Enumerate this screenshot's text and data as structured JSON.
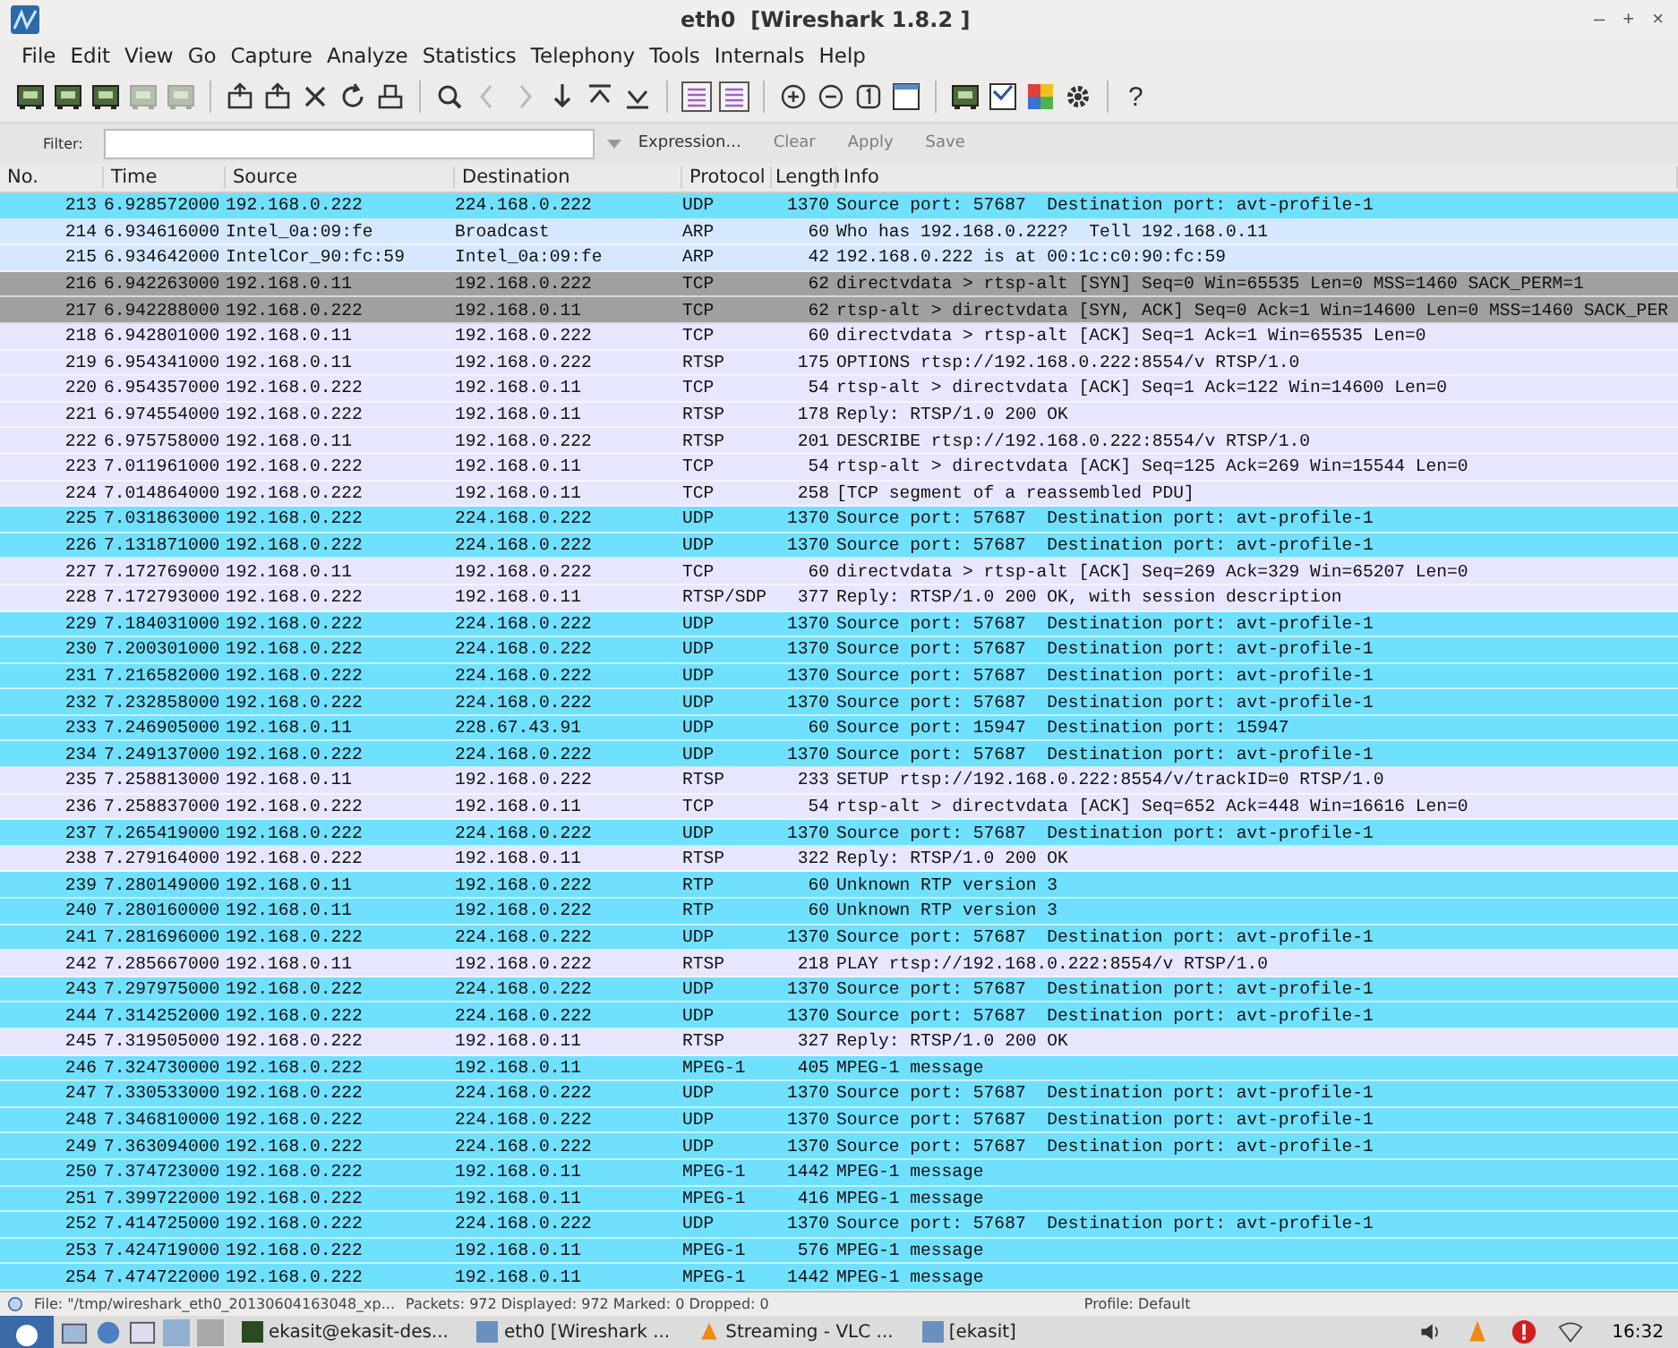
{
  "window": {
    "title": "eth0  [Wireshark 1.8.2 ]",
    "controls": [
      "–",
      "+",
      "×"
    ]
  },
  "menu": [
    "File",
    "Edit",
    "View",
    "Go",
    "Capture",
    "Analyze",
    "Statistics",
    "Telephony",
    "Tools",
    "Internals",
    "Help"
  ],
  "toolbar": {
    "help": "?"
  },
  "filter": {
    "label": "Filter:",
    "buttons": [
      {
        "label": "Expression...",
        "disabled": false
      },
      {
        "label": "Clear",
        "disabled": true
      },
      {
        "label": "Apply",
        "disabled": true
      },
      {
        "label": "Save",
        "disabled": true
      }
    ]
  },
  "table": {
    "columns": [
      "No.",
      "Time",
      "Source",
      "Destination",
      "Protocol",
      "Length",
      "Info"
    ],
    "rows": [
      {
        "no": "213",
        "time": "6.928572000",
        "source": "192.168.0.222",
        "destination": "224.168.0.222",
        "protocol": "UDP",
        "length": "1370",
        "info": "Source port: 57687  Destination port: avt-profile-1",
        "color": "#70e0ff"
      },
      {
        "no": "214",
        "time": "6.934616000",
        "source": "Intel_0a:09:fe",
        "destination": "Broadcast",
        "protocol": "ARP",
        "length": "60",
        "info": "Who has 192.168.0.222?  Tell 192.168.0.11",
        "color": "#d6e8ff"
      },
      {
        "no": "215",
        "time": "6.934642000",
        "source": "IntelCor_90:fc:59",
        "destination": "Intel_0a:09:fe",
        "protocol": "ARP",
        "length": "42",
        "info": "192.168.0.222 is at 00:1c:c0:90:fc:59",
        "color": "#d6e8ff"
      },
      {
        "no": "216",
        "time": "6.942263000",
        "source": "192.168.0.11",
        "destination": "192.168.0.222",
        "protocol": "TCP",
        "length": "62",
        "info": "directvdata > rtsp-alt [SYN] Seq=0 Win=65535 Len=0 MSS=1460 SACK_PERM=1",
        "color": "#a0a0a0"
      },
      {
        "no": "217",
        "time": "6.942288000",
        "source": "192.168.0.222",
        "destination": "192.168.0.11",
        "protocol": "TCP",
        "length": "62",
        "info": "rtsp-alt > directvdata [SYN, ACK] Seq=0 Ack=1 Win=14600 Len=0 MSS=1460 SACK_PER",
        "color": "#a0a0a0"
      },
      {
        "no": "218",
        "time": "6.942801000",
        "source": "192.168.0.11",
        "destination": "192.168.0.222",
        "protocol": "TCP",
        "length": "60",
        "info": "directvdata > rtsp-alt [ACK] Seq=1 Ack=1 Win=65535 Len=0",
        "color": "#e7e6ff"
      },
      {
        "no": "219",
        "time": "6.954341000",
        "source": "192.168.0.11",
        "destination": "192.168.0.222",
        "protocol": "RTSP",
        "length": "175",
        "info": "OPTIONS rtsp://192.168.0.222:8554/v RTSP/1.0",
        "color": "#e7e6ff"
      },
      {
        "no": "220",
        "time": "6.954357000",
        "source": "192.168.0.222",
        "destination": "192.168.0.11",
        "protocol": "TCP",
        "length": "54",
        "info": "rtsp-alt > directvdata [ACK] Seq=1 Ack=122 Win=14600 Len=0",
        "color": "#e7e6ff"
      },
      {
        "no": "221",
        "time": "6.974554000",
        "source": "192.168.0.222",
        "destination": "192.168.0.11",
        "protocol": "RTSP",
        "length": "178",
        "info": "Reply: RTSP/1.0 200 OK",
        "color": "#e7e6ff"
      },
      {
        "no": "222",
        "time": "6.975758000",
        "source": "192.168.0.11",
        "destination": "192.168.0.222",
        "protocol": "RTSP",
        "length": "201",
        "info": "DESCRIBE rtsp://192.168.0.222:8554/v RTSP/1.0",
        "color": "#e7e6ff"
      },
      {
        "no": "223",
        "time": "7.011961000",
        "source": "192.168.0.222",
        "destination": "192.168.0.11",
        "protocol": "TCP",
        "length": "54",
        "info": "rtsp-alt > directvdata [ACK] Seq=125 Ack=269 Win=15544 Len=0",
        "color": "#e7e6ff"
      },
      {
        "no": "224",
        "time": "7.014864000",
        "source": "192.168.0.222",
        "destination": "192.168.0.11",
        "protocol": "TCP",
        "length": "258",
        "info": "[TCP segment of a reassembled PDU]",
        "color": "#e7e6ff"
      },
      {
        "no": "225",
        "time": "7.031863000",
        "source": "192.168.0.222",
        "destination": "224.168.0.222",
        "protocol": "UDP",
        "length": "1370",
        "info": "Source port: 57687  Destination port: avt-profile-1",
        "color": "#70e0ff"
      },
      {
        "no": "226",
        "time": "7.131871000",
        "source": "192.168.0.222",
        "destination": "224.168.0.222",
        "protocol": "UDP",
        "length": "1370",
        "info": "Source port: 57687  Destination port: avt-profile-1",
        "color": "#70e0ff"
      },
      {
        "no": "227",
        "time": "7.172769000",
        "source": "192.168.0.11",
        "destination": "192.168.0.222",
        "protocol": "TCP",
        "length": "60",
        "info": "directvdata > rtsp-alt [ACK] Seq=269 Ack=329 Win=65207 Len=0",
        "color": "#e7e6ff"
      },
      {
        "no": "228",
        "time": "7.172793000",
        "source": "192.168.0.222",
        "destination": "192.168.0.11",
        "protocol": "RTSP/SDP",
        "length": "377",
        "info": "Reply: RTSP/1.0 200 OK, with session description",
        "color": "#e7e6ff"
      },
      {
        "no": "229",
        "time": "7.184031000",
        "source": "192.168.0.222",
        "destination": "224.168.0.222",
        "protocol": "UDP",
        "length": "1370",
        "info": "Source port: 57687  Destination port: avt-profile-1",
        "color": "#70e0ff"
      },
      {
        "no": "230",
        "time": "7.200301000",
        "source": "192.168.0.222",
        "destination": "224.168.0.222",
        "protocol": "UDP",
        "length": "1370",
        "info": "Source port: 57687  Destination port: avt-profile-1",
        "color": "#70e0ff"
      },
      {
        "no": "231",
        "time": "7.216582000",
        "source": "192.168.0.222",
        "destination": "224.168.0.222",
        "protocol": "UDP",
        "length": "1370",
        "info": "Source port: 57687  Destination port: avt-profile-1",
        "color": "#70e0ff"
      },
      {
        "no": "232",
        "time": "7.232858000",
        "source": "192.168.0.222",
        "destination": "224.168.0.222",
        "protocol": "UDP",
        "length": "1370",
        "info": "Source port: 57687  Destination port: avt-profile-1",
        "color": "#70e0ff"
      },
      {
        "no": "233",
        "time": "7.246905000",
        "source": "192.168.0.11",
        "destination": "228.67.43.91",
        "protocol": "UDP",
        "length": "60",
        "info": "Source port: 15947  Destination port: 15947",
        "color": "#70e0ff"
      },
      {
        "no": "234",
        "time": "7.249137000",
        "source": "192.168.0.222",
        "destination": "224.168.0.222",
        "protocol": "UDP",
        "length": "1370",
        "info": "Source port: 57687  Destination port: avt-profile-1",
        "color": "#70e0ff"
      },
      {
        "no": "235",
        "time": "7.258813000",
        "source": "192.168.0.11",
        "destination": "192.168.0.222",
        "protocol": "RTSP",
        "length": "233",
        "info": "SETUP rtsp://192.168.0.222:8554/v/trackID=0 RTSP/1.0",
        "color": "#e7e6ff"
      },
      {
        "no": "236",
        "time": "7.258837000",
        "source": "192.168.0.222",
        "destination": "192.168.0.11",
        "protocol": "TCP",
        "length": "54",
        "info": "rtsp-alt > directvdata [ACK] Seq=652 Ack=448 Win=16616 Len=0",
        "color": "#e7e6ff"
      },
      {
        "no": "237",
        "time": "7.265419000",
        "source": "192.168.0.222",
        "destination": "224.168.0.222",
        "protocol": "UDP",
        "length": "1370",
        "info": "Source port: 57687  Destination port: avt-profile-1",
        "color": "#70e0ff"
      },
      {
        "no": "238",
        "time": "7.279164000",
        "source": "192.168.0.222",
        "destination": "192.168.0.11",
        "protocol": "RTSP",
        "length": "322",
        "info": "Reply: RTSP/1.0 200 OK",
        "color": "#e7e6ff"
      },
      {
        "no": "239",
        "time": "7.280149000",
        "source": "192.168.0.11",
        "destination": "192.168.0.222",
        "protocol": "RTP",
        "length": "60",
        "info": "Unknown RTP version 3",
        "color": "#70e0ff"
      },
      {
        "no": "240",
        "time": "7.280160000",
        "source": "192.168.0.11",
        "destination": "192.168.0.222",
        "protocol": "RTP",
        "length": "60",
        "info": "Unknown RTP version 3",
        "color": "#70e0ff"
      },
      {
        "no": "241",
        "time": "7.281696000",
        "source": "192.168.0.222",
        "destination": "224.168.0.222",
        "protocol": "UDP",
        "length": "1370",
        "info": "Source port: 57687  Destination port: avt-profile-1",
        "color": "#70e0ff"
      },
      {
        "no": "242",
        "time": "7.285667000",
        "source": "192.168.0.11",
        "destination": "192.168.0.222",
        "protocol": "RTSP",
        "length": "218",
        "info": "PLAY rtsp://192.168.0.222:8554/v RTSP/1.0",
        "color": "#e7e6ff"
      },
      {
        "no": "243",
        "time": "7.297975000",
        "source": "192.168.0.222",
        "destination": "224.168.0.222",
        "protocol": "UDP",
        "length": "1370",
        "info": "Source port: 57687  Destination port: avt-profile-1",
        "color": "#70e0ff"
      },
      {
        "no": "244",
        "time": "7.314252000",
        "source": "192.168.0.222",
        "destination": "224.168.0.222",
        "protocol": "UDP",
        "length": "1370",
        "info": "Source port: 57687  Destination port: avt-profile-1",
        "color": "#70e0ff"
      },
      {
        "no": "245",
        "time": "7.319505000",
        "source": "192.168.0.222",
        "destination": "192.168.0.11",
        "protocol": "RTSP",
        "length": "327",
        "info": "Reply: RTSP/1.0 200 OK",
        "color": "#e7e6ff"
      },
      {
        "no": "246",
        "time": "7.324730000",
        "source": "192.168.0.222",
        "destination": "192.168.0.11",
        "protocol": "MPEG-1",
        "length": "405",
        "info": "MPEG-1 message",
        "color": "#70e0ff"
      },
      {
        "no": "247",
        "time": "7.330533000",
        "source": "192.168.0.222",
        "destination": "224.168.0.222",
        "protocol": "UDP",
        "length": "1370",
        "info": "Source port: 57687  Destination port: avt-profile-1",
        "color": "#70e0ff"
      },
      {
        "no": "248",
        "time": "7.346810000",
        "source": "192.168.0.222",
        "destination": "224.168.0.222",
        "protocol": "UDP",
        "length": "1370",
        "info": "Source port: 57687  Destination port: avt-profile-1",
        "color": "#70e0ff"
      },
      {
        "no": "249",
        "time": "7.363094000",
        "source": "192.168.0.222",
        "destination": "224.168.0.222",
        "protocol": "UDP",
        "length": "1370",
        "info": "Source port: 57687  Destination port: avt-profile-1",
        "color": "#70e0ff"
      },
      {
        "no": "250",
        "time": "7.374723000",
        "source": "192.168.0.222",
        "destination": "192.168.0.11",
        "protocol": "MPEG-1",
        "length": "1442",
        "info": "MPEG-1 message",
        "color": "#70e0ff"
      },
      {
        "no": "251",
        "time": "7.399722000",
        "source": "192.168.0.222",
        "destination": "192.168.0.11",
        "protocol": "MPEG-1",
        "length": "416",
        "info": "MPEG-1 message",
        "color": "#70e0ff"
      },
      {
        "no": "252",
        "time": "7.414725000",
        "source": "192.168.0.222",
        "destination": "224.168.0.222",
        "protocol": "UDP",
        "length": "1370",
        "info": "Source port: 57687  Destination port: avt-profile-1",
        "color": "#70e0ff"
      },
      {
        "no": "253",
        "time": "7.424719000",
        "source": "192.168.0.222",
        "destination": "192.168.0.11",
        "protocol": "MPEG-1",
        "length": "576",
        "info": "MPEG-1 message",
        "color": "#70e0ff"
      },
      {
        "no": "254",
        "time": "7.474722000",
        "source": "192.168.0.222",
        "destination": "192.168.0.11",
        "protocol": "MPEG-1",
        "length": "1442",
        "info": "MPEG-1 message",
        "color": "#70e0ff"
      }
    ]
  },
  "status_bar": {
    "file": "File: \"/tmp/wireshark_eth0_20130604163048_xp...",
    "packets": "Packets: 972 Displayed: 972 Marked: 0 Dropped: 0",
    "profile": "Profile: Default"
  },
  "taskbar": {
    "items": [
      "ekasit@ekasit-des...",
      "eth0  [Wireshark ...",
      "Streaming - VLC ...",
      "[ekasit]"
    ],
    "clock": "16:32"
  }
}
